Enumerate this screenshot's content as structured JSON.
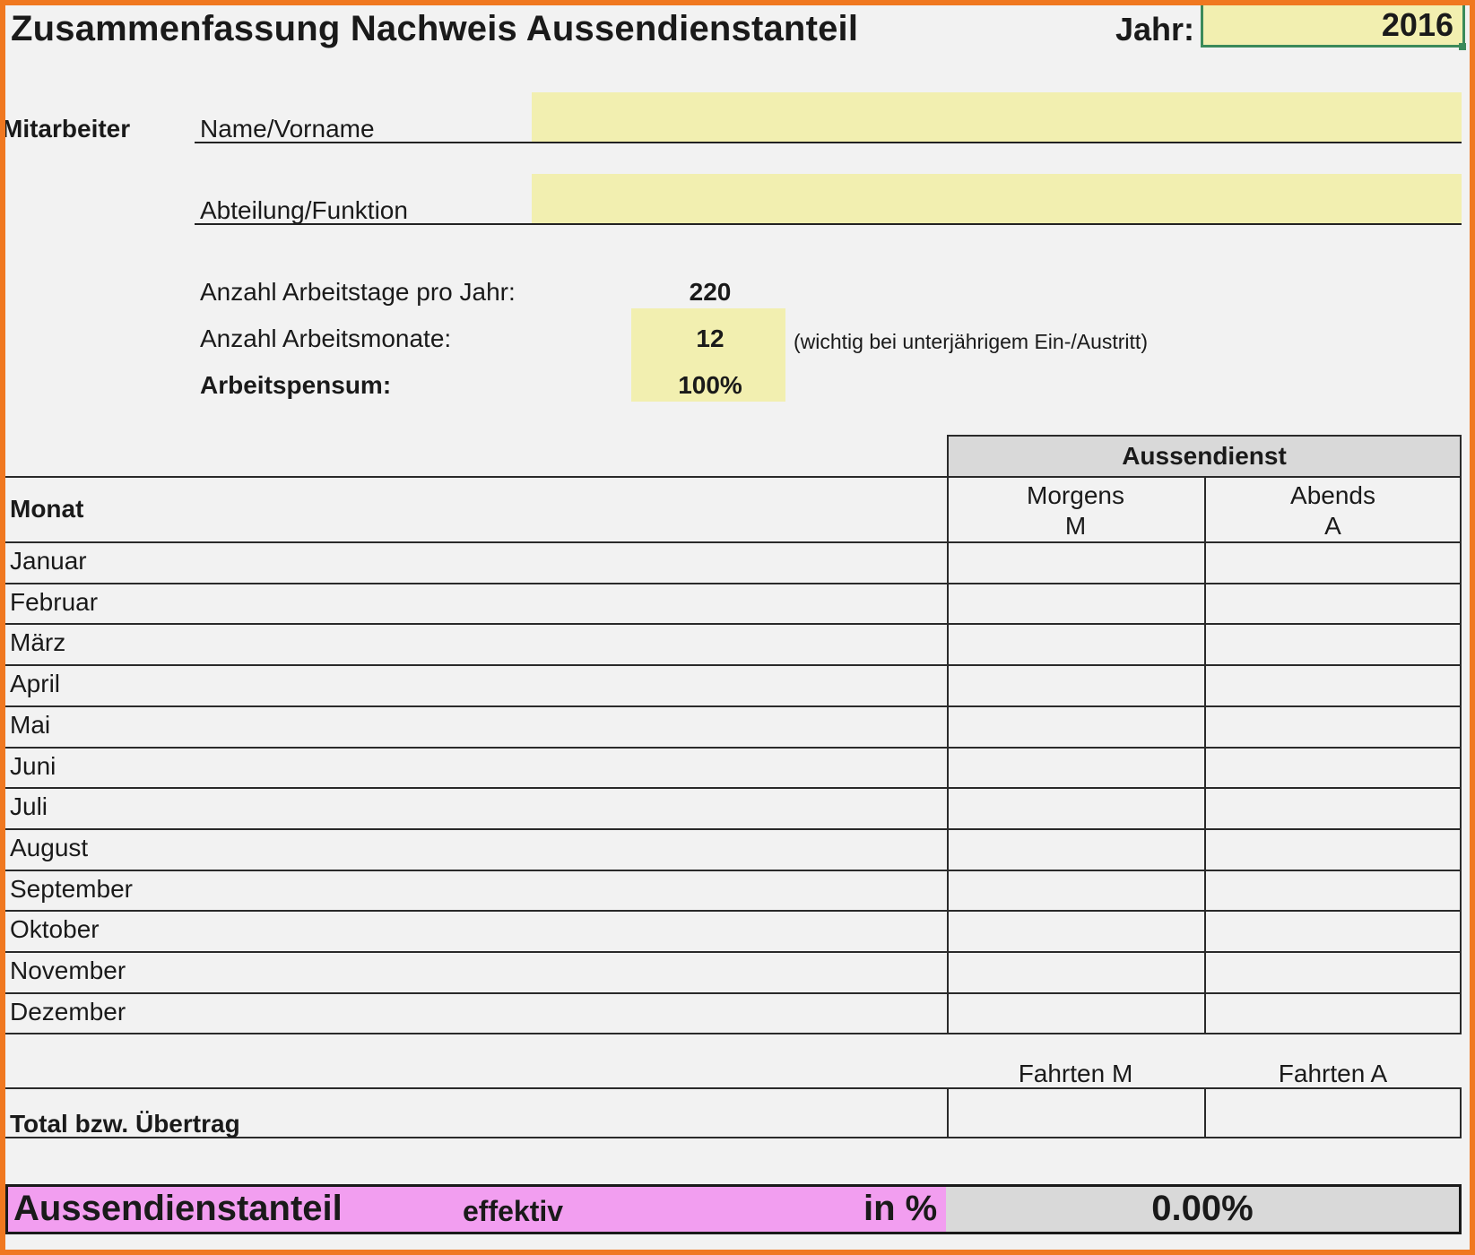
{
  "header": {
    "title": "Zusammenfassung Nachweis Aussendienstanteil",
    "year_label": "Jahr:",
    "year_value": "2016"
  },
  "employee": {
    "section_label": "Mitarbeiter",
    "name_label": "Name/Vorname",
    "name_value": "",
    "department_label": "Abteilung/Funktion",
    "department_value": ""
  },
  "stats": {
    "workdays_label": "Anzahl Arbeitstage pro Jahr:",
    "workdays_value": "220",
    "workmonths_label": "Anzahl Arbeitsmonate:",
    "workmonths_value": "12",
    "workmonths_note": "(wichtig bei unterjährigem Ein-/Austritt)",
    "workload_label": "Arbeitspensum:",
    "workload_value": "100%"
  },
  "table": {
    "group_header": "Aussendienst",
    "month_header": "Monat",
    "morning_header_line1": "Morgens",
    "morning_header_line2": "M",
    "evening_header_line1": "Abends",
    "evening_header_line2": "A",
    "rows": [
      {
        "month": "Januar",
        "m": "",
        "a": ""
      },
      {
        "month": "Februar",
        "m": "",
        "a": ""
      },
      {
        "month": "März",
        "m": "",
        "a": ""
      },
      {
        "month": "April",
        "m": "",
        "a": ""
      },
      {
        "month": "Mai",
        "m": "",
        "a": ""
      },
      {
        "month": "Juni",
        "m": "",
        "a": ""
      },
      {
        "month": "Juli",
        "m": "",
        "a": ""
      },
      {
        "month": "August",
        "m": "",
        "a": ""
      },
      {
        "month": "September",
        "m": "",
        "a": ""
      },
      {
        "month": "Oktober",
        "m": "",
        "a": ""
      },
      {
        "month": "November",
        "m": "",
        "a": ""
      },
      {
        "month": "Dezember",
        "m": "",
        "a": ""
      }
    ]
  },
  "totals": {
    "trips_m_label": "Fahrten M",
    "trips_a_label": "Fahrten A",
    "total_label": "Total bzw. Übertrag",
    "trips_m_value": "",
    "trips_a_value": ""
  },
  "result": {
    "title": "Aussendienstanteil",
    "qualifier": "effektiv",
    "unit_label": "in %",
    "value": "0.00%"
  },
  "colors": {
    "frame": "#f07820",
    "input_yellow": "#f2efb0",
    "result_pink": "#f29ef0",
    "header_gray": "#d9d9d9"
  }
}
